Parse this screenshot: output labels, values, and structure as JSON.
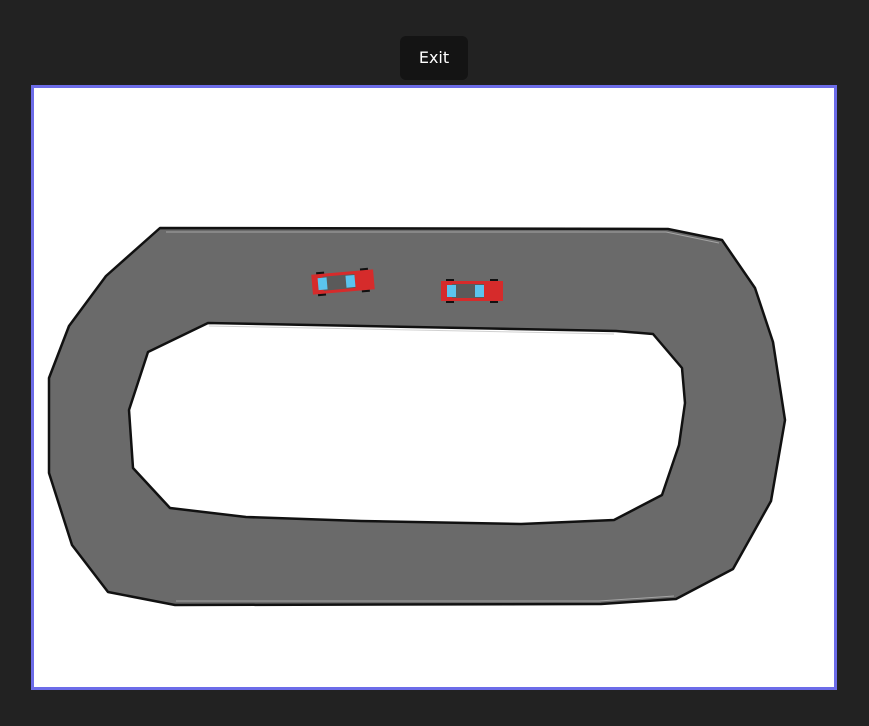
{
  "controls": {
    "exit_label": "Exit"
  },
  "colors": {
    "page_background": "#222222",
    "button_background": "#141414",
    "canvas_border": "#6c6ce8",
    "canvas_background": "#ffffff",
    "track_fill": "#6a6a6a",
    "track_edge": "#111111",
    "car_body": "#d62b2b",
    "car_window": "#5bc4ee",
    "car_roof": "#5a5a5a",
    "car_wheel": "#111111"
  },
  "game": {
    "cars": [
      {
        "name": "player-car",
        "heading_deg": -5
      },
      {
        "name": "opponent-car",
        "heading_deg": 0
      }
    ]
  }
}
